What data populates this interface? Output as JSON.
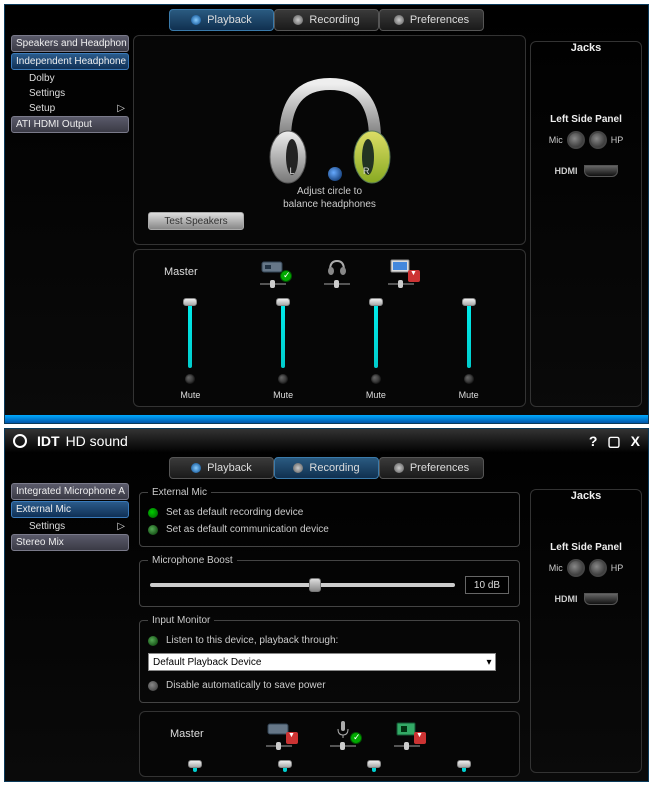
{
  "brand": {
    "logo": "IDT",
    "name": "HD sound"
  },
  "title_ctrls": {
    "help": "?",
    "max": "▢",
    "close": "X"
  },
  "tabs": {
    "playback": "Playback",
    "recording": "Recording",
    "preferences": "Preferences"
  },
  "w1": {
    "sidebar": {
      "items": [
        "Speakers and Headphon",
        "Independent Headphone",
        "ATI HDMI Output"
      ],
      "subs": {
        "dolby": "Dolby",
        "settings": "Settings",
        "setup": "Setup",
        "arrow": "▷"
      }
    },
    "hp": {
      "test": "Test Speakers",
      "l": "L",
      "r": "R",
      "caption1": "Adjust circle to",
      "caption2": "balance headphones"
    },
    "mixer": {
      "master": "Master",
      "mute": "Mute"
    }
  },
  "w2": {
    "sidebar": {
      "items": [
        "Integrated Microphone A",
        "External Mic",
        "Stereo Mix"
      ],
      "subs": {
        "settings": "Settings",
        "arrow": "▷"
      }
    },
    "groups": {
      "g1": {
        "legend": "External Mic",
        "opt1": "Set as default recording device",
        "opt2": "Set as default communication device"
      },
      "g2": {
        "legend": "Microphone Boost",
        "value": "10 dB"
      },
      "g3": {
        "legend": "Input Monitor",
        "opt1": "Listen to this device, playback through:",
        "dropdown": "Default Playback Device",
        "opt2": "Disable automatically to save power"
      }
    },
    "mixer": {
      "master": "Master"
    }
  },
  "jacks": {
    "title": "Jacks",
    "panel": "Left Side Panel",
    "mic": "Mic",
    "hp": "HP",
    "hdmi": "HDMI"
  }
}
